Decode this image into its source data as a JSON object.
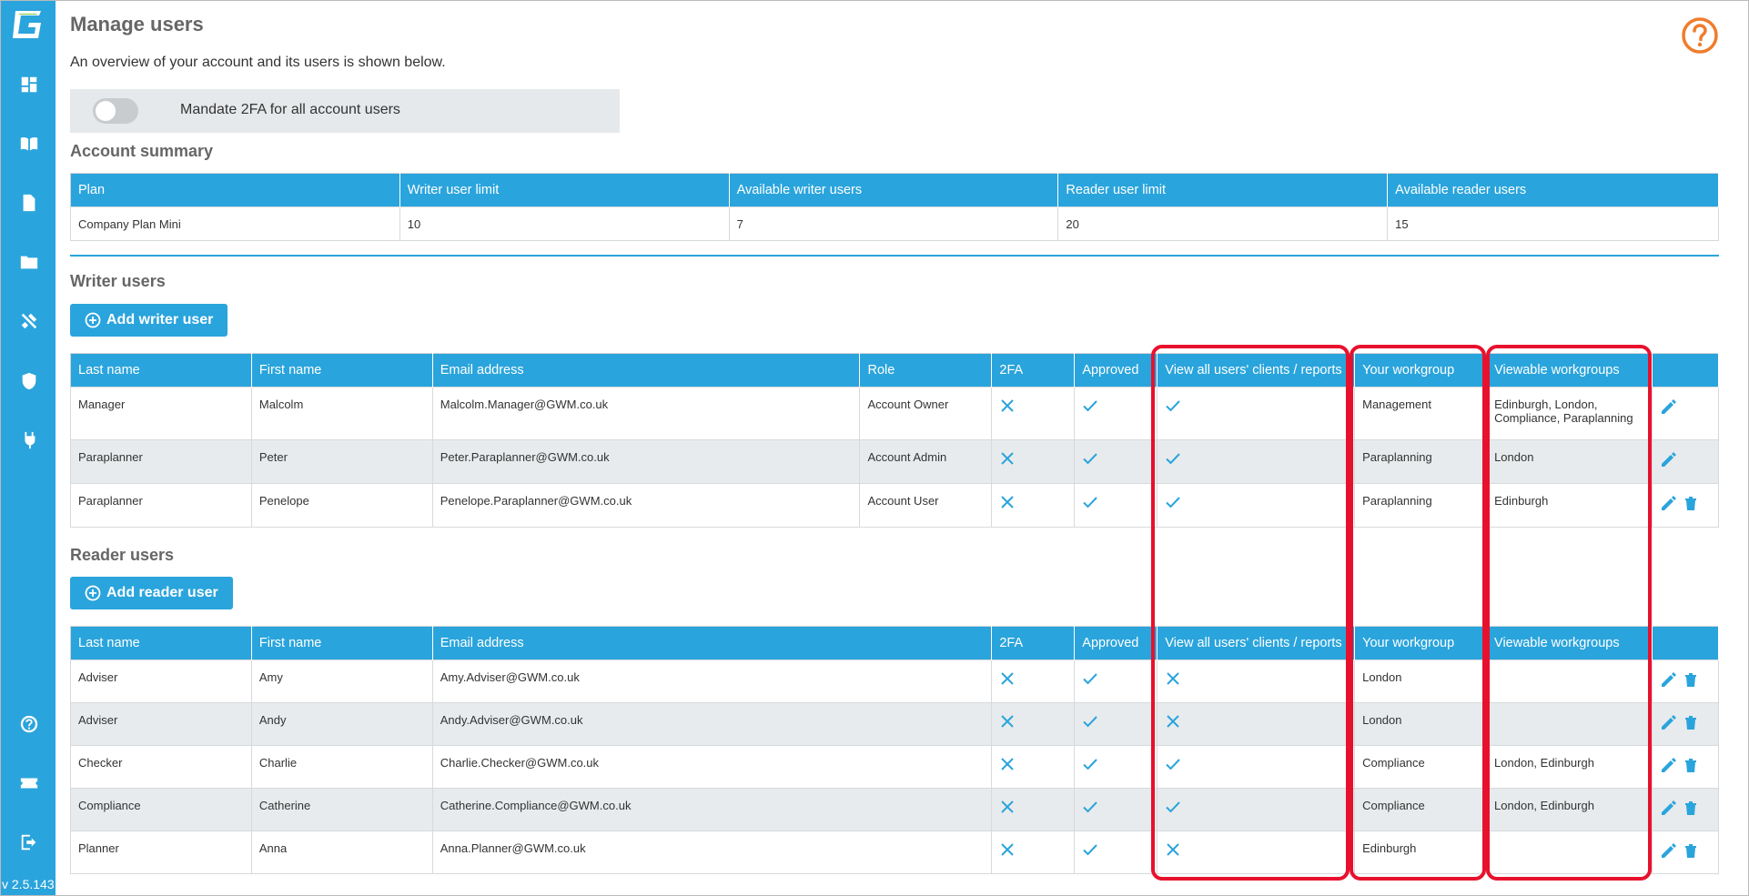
{
  "app": {
    "version": "v 2.5.143",
    "accent": "#2aa4dc",
    "highlight": "#e8112d",
    "help_color": "#f07c2c"
  },
  "sidebar": {
    "items": [
      {
        "icon": "dashboard-icon"
      },
      {
        "icon": "book-icon"
      },
      {
        "icon": "document-icon"
      },
      {
        "icon": "folder-icon"
      },
      {
        "icon": "tools-icon"
      },
      {
        "icon": "shield-icon"
      },
      {
        "icon": "plug-icon"
      }
    ],
    "bottom": [
      {
        "icon": "help-icon"
      },
      {
        "icon": "ticket-icon"
      },
      {
        "icon": "logout-icon"
      }
    ]
  },
  "page": {
    "title": "Manage users",
    "subtitle": "An overview of your account and its users is shown below.",
    "mandate_label": "Mandate 2FA for all account users",
    "mandate_enabled": false
  },
  "summary": {
    "title": "Account summary",
    "headers": [
      "Plan",
      "Writer user limit",
      "Available writer users",
      "Reader user limit",
      "Available reader users"
    ],
    "row": [
      "Company Plan Mini",
      "10",
      "7",
      "20",
      "15"
    ]
  },
  "writer": {
    "title": "Writer users",
    "add_label": "Add writer user",
    "headers": [
      "Last name",
      "First name",
      "Email address",
      "Role",
      "2FA",
      "Approved",
      "View all users' clients / reports",
      "Your workgroup",
      "Viewable workgroups"
    ],
    "rows": [
      {
        "last": "Manager",
        "first": "Malcolm",
        "email": "Malcolm.Manager@GWM.co.uk",
        "role": "Account Owner",
        "twofa": false,
        "approved": true,
        "viewall": true,
        "workgroup": "Management",
        "viewable": "Edinburgh, London, Compliance, Paraplanning",
        "deletable": false
      },
      {
        "last": "Paraplanner",
        "first": "Peter",
        "email": "Peter.Paraplanner@GWM.co.uk",
        "role": "Account Admin",
        "twofa": false,
        "approved": true,
        "viewall": true,
        "workgroup": "Paraplanning",
        "viewable": "London",
        "deletable": false
      },
      {
        "last": "Paraplanner",
        "first": "Penelope",
        "email": "Penelope.Paraplanner@GWM.co.uk",
        "role": "Account User",
        "twofa": false,
        "approved": true,
        "viewall": true,
        "workgroup": "Paraplanning",
        "viewable": "Edinburgh",
        "deletable": true
      }
    ]
  },
  "reader": {
    "title": "Reader users",
    "add_label": "Add reader user",
    "headers": [
      "Last name",
      "First name",
      "Email address",
      "2FA",
      "Approved",
      "View all users' clients / reports",
      "Your workgroup",
      "Viewable workgroups"
    ],
    "rows": [
      {
        "last": "Adviser",
        "first": "Amy",
        "email": "Amy.Adviser@GWM.co.uk",
        "twofa": false,
        "approved": true,
        "viewall": false,
        "workgroup": "London",
        "viewable": ""
      },
      {
        "last": "Adviser",
        "first": "Andy",
        "email": "Andy.Adviser@GWM.co.uk",
        "twofa": false,
        "approved": true,
        "viewall": false,
        "workgroup": "London",
        "viewable": ""
      },
      {
        "last": "Checker",
        "first": "Charlie",
        "email": "Charlie.Checker@GWM.co.uk",
        "twofa": false,
        "approved": true,
        "viewall": true,
        "workgroup": "Compliance",
        "viewable": "London, Edinburgh"
      },
      {
        "last": "Compliance",
        "first": "Catherine",
        "email": "Catherine.Compliance@GWM.co.uk",
        "twofa": false,
        "approved": true,
        "viewall": true,
        "workgroup": "Compliance",
        "viewable": "London, Edinburgh"
      },
      {
        "last": "Planner",
        "first": "Anna",
        "email": "Anna.Planner@GWM.co.uk",
        "twofa": false,
        "approved": true,
        "viewall": false,
        "workgroup": "Edinburgh",
        "viewable": ""
      }
    ]
  }
}
